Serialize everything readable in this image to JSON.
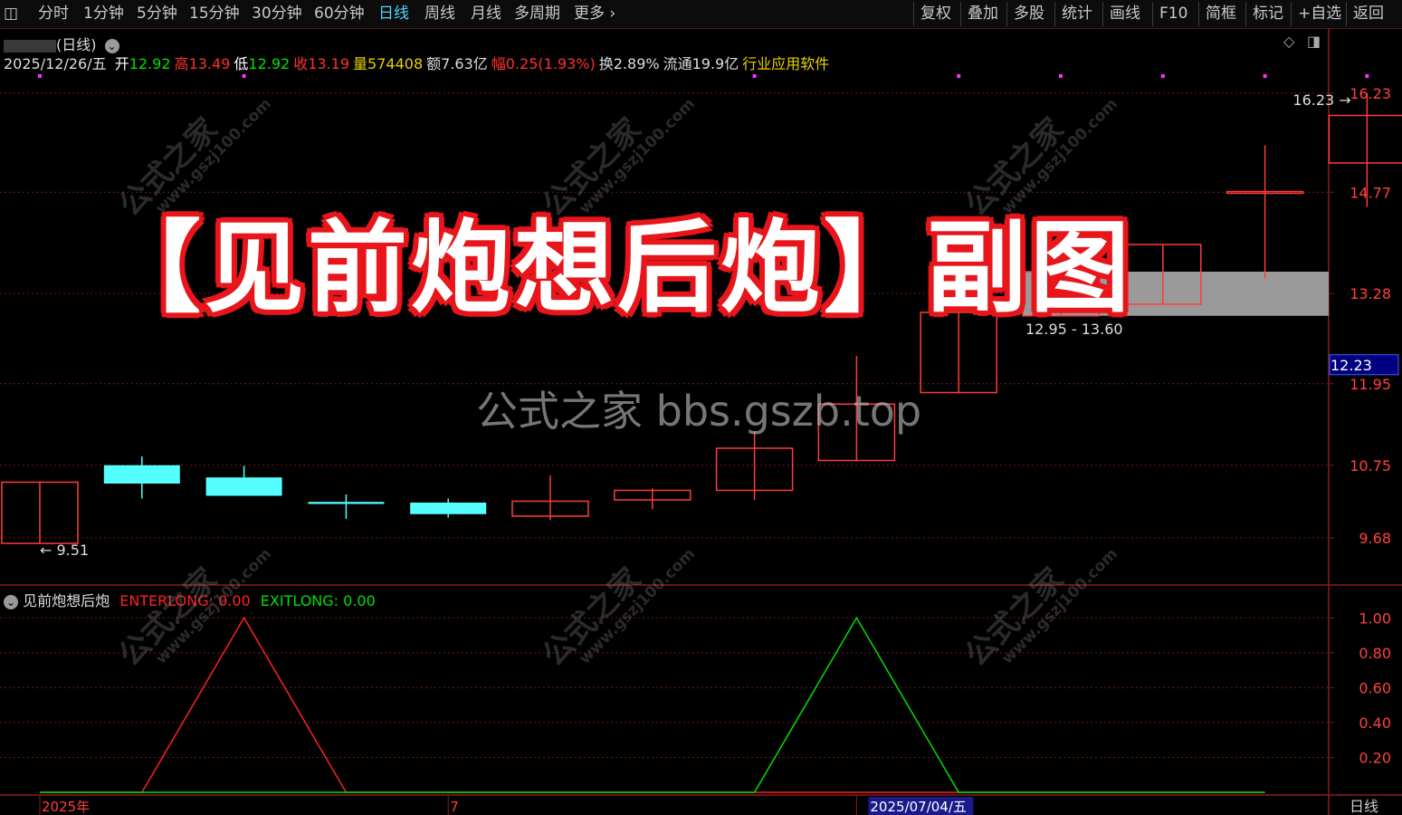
{
  "toolbar": {
    "left_items": [
      "分时",
      "1分钟",
      "5分钟",
      "15分钟",
      "30分钟",
      "60分钟",
      "日线",
      "周线",
      "月线",
      "多周期",
      "更多"
    ],
    "active": "日线",
    "right_items": [
      "复权",
      "叠加",
      "多股",
      "统计",
      "画线",
      "F10",
      "简框",
      "标记",
      "+自选",
      "返回"
    ]
  },
  "stock_header": {
    "name": "(日线)",
    "date": "2025/12/26/五",
    "fields": [
      {
        "label": "开",
        "value": "12.92",
        "label_color": "#ffffff",
        "value_color": "#00e000"
      },
      {
        "label": "高",
        "value": "13.49",
        "label_color": "#ff3030",
        "value_color": "#ff3030"
      },
      {
        "label": "低",
        "value": "12.92",
        "label_color": "#ffffff",
        "value_color": "#00e000"
      },
      {
        "label": "收",
        "value": "13.19",
        "label_color": "#ff3030",
        "value_color": "#ff3030"
      },
      {
        "label": "量",
        "value": "574408",
        "label_color": "#e8d000",
        "value_color": "#e8d000"
      },
      {
        "label": "额",
        "value": "7.63亿",
        "label_color": "#dddddd",
        "value_color": "#dddddd"
      },
      {
        "label": "幅",
        "value": "0.25(1.93%)",
        "label_color": "#ff3030",
        "value_color": "#ff3030"
      },
      {
        "label": "换",
        "value": "2.89%",
        "label_color": "#dddddd",
        "value_color": "#dddddd"
      },
      {
        "label": "流通",
        "value": "19.9亿",
        "label_color": "#dddddd",
        "value_color": "#dddddd"
      },
      {
        "label": "",
        "value": "行业应用软件",
        "label_color": "#e8d000",
        "value_color": "#e8d000"
      }
    ]
  },
  "overlay": {
    "title": "【见前炮想后炮】副图",
    "watermark": "公式之家 bbs.gszb.top",
    "tile_watermark_cn": "公式之家",
    "tile_watermark_url": "www.gszj100.com"
  },
  "colors": {
    "up": "#ff3c3c",
    "down": "#55ffff",
    "enter": "#ff2020",
    "exit": "#00e000",
    "grid": "#7a1a1a",
    "axis_text": "#ff4040"
  },
  "chart_data": [
    {
      "type": "candlestick",
      "title": "",
      "ylim": [
        9.0,
        16.6
      ],
      "y_ticks": [
        9.68,
        10.75,
        11.95,
        13.28,
        14.77,
        16.23
      ],
      "current_price": "12.23",
      "candles": [
        {
          "open": 9.6,
          "close": 10.5,
          "high": 10.5,
          "low": 9.6
        },
        {
          "open": 10.75,
          "close": 10.48,
          "high": 10.88,
          "low": 10.26
        },
        {
          "open": 10.57,
          "close": 10.3,
          "high": 10.74,
          "low": 10.3
        },
        {
          "open": 10.21,
          "close": 10.18,
          "high": 10.32,
          "low": 9.96
        },
        {
          "open": 10.2,
          "close": 10.03,
          "high": 10.26,
          "low": 9.98
        },
        {
          "open": 10.0,
          "close": 10.22,
          "high": 10.6,
          "low": 9.94
        },
        {
          "open": 10.24,
          "close": 10.38,
          "high": 10.41,
          "low": 10.1
        },
        {
          "open": 10.38,
          "close": 11.0,
          "high": 11.25,
          "low": 10.24
        },
        {
          "open": 10.82,
          "close": 11.65,
          "high": 12.36,
          "low": 10.82
        },
        {
          "open": 11.82,
          "close": 13.0,
          "high": 13.0,
          "low": 11.82
        },
        {
          "open": 12.95,
          "close": 13.6,
          "high": 13.6,
          "low": 12.95
        },
        {
          "open": 13.12,
          "close": 14.0,
          "high": 14.0,
          "low": 13.12
        },
        {
          "open": 14.78,
          "close": 14.78,
          "high": 15.46,
          "low": 13.5
        },
        {
          "open": 15.2,
          "close": 15.9,
          "high": 16.23,
          "low": 14.55
        }
      ],
      "annotations": [
        {
          "text": "16.23",
          "candle": 13,
          "price": 16.23,
          "arrow": "→"
        },
        {
          "text": "9.51",
          "candle": 0,
          "price": 9.51,
          "arrow": "←"
        },
        {
          "text": "12.95 - 13.60",
          "candle": 10,
          "price": 12.95
        }
      ],
      "zone": {
        "from": 12.95,
        "to": 13.6,
        "start_candle": 10
      },
      "marker_candles": [
        0,
        2,
        7,
        9,
        10,
        11,
        12,
        13
      ]
    },
    {
      "type": "line",
      "title": "见前炮想后炮",
      "ylim": [
        0,
        1.1
      ],
      "y_ticks": [
        "1.00",
        "0.80",
        "0.60",
        "0.40",
        "0.20"
      ],
      "x_labels": [
        {
          "text": "2025年",
          "index": 0
        },
        {
          "text": "7",
          "index": 4
        },
        {
          "text": "2025/07/04/五",
          "index": 8
        }
      ],
      "series": [
        {
          "name": "ENTERLONG",
          "current": "0.00",
          "values": [
            0,
            0,
            1,
            0,
            0,
            0,
            0,
            0,
            0,
            0,
            0,
            0,
            0
          ]
        },
        {
          "name": "EXITLONG",
          "current": "0.00",
          "values": [
            0,
            0,
            0,
            0,
            0,
            0,
            0,
            0,
            1,
            0,
            0,
            0,
            0
          ]
        }
      ],
      "period_label": "日线"
    }
  ]
}
